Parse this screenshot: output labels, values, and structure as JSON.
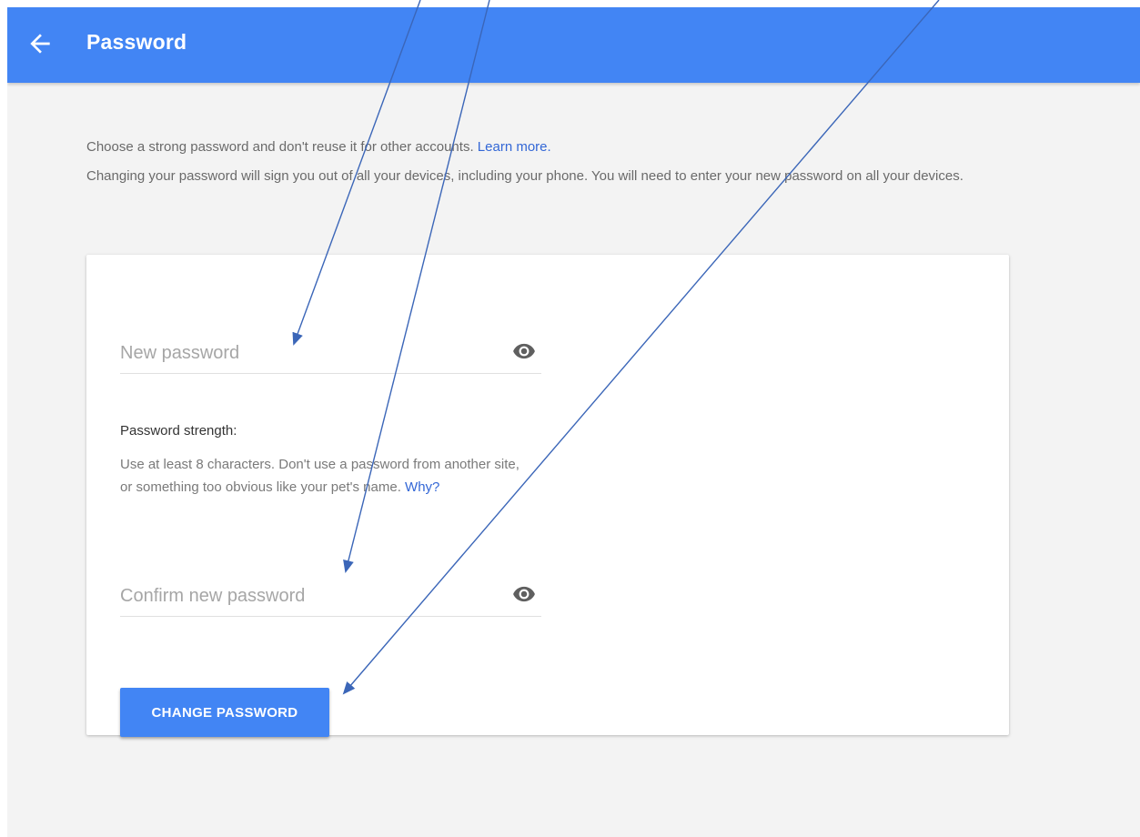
{
  "header": {
    "title": "Password",
    "back_icon": "arrow-left-icon",
    "color": "#4285f4"
  },
  "intro": {
    "line1": "Choose a strong password and don't reuse it for other accounts.",
    "learn_more": "Learn more.",
    "line2": "Changing your password will sign you out of all your devices, including your phone. You will need to enter your new password on all your devices."
  },
  "form": {
    "new_password": {
      "placeholder": "New password",
      "value": "",
      "icon": "eye-icon"
    },
    "strength": {
      "label": "Password strength:",
      "help": "Use at least 8 characters. Don't use a password from another site, or something too obvious like your pet's name.",
      "why": "Why?"
    },
    "confirm_password": {
      "placeholder": "Confirm new password",
      "value": "",
      "icon": "eye-icon"
    },
    "submit_label": "CHANGE PASSWORD"
  },
  "colors": {
    "accent": "#4285f4",
    "link": "#3367d6",
    "background": "#f3f3f3",
    "annotation": "#3b66b8"
  }
}
